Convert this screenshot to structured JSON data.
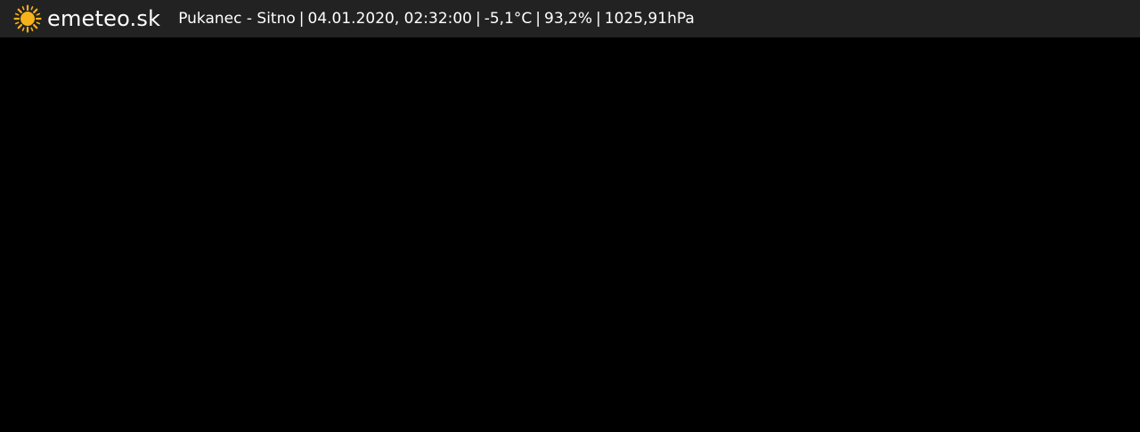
{
  "header": {
    "logo_icon": "sun-icon",
    "brand": "emeteo.sk",
    "station": "Pukanec - Sitno",
    "separator": "|",
    "datetime": "04.01.2020, 02:32:00",
    "temperature": "-5,1°C",
    "humidity": "93,2%",
    "pressure": "1025,91hPa"
  },
  "colors": {
    "topbar_bg": "#222222",
    "page_bg": "#000000",
    "text": "#ffffff",
    "sun": "#f6b21b"
  }
}
